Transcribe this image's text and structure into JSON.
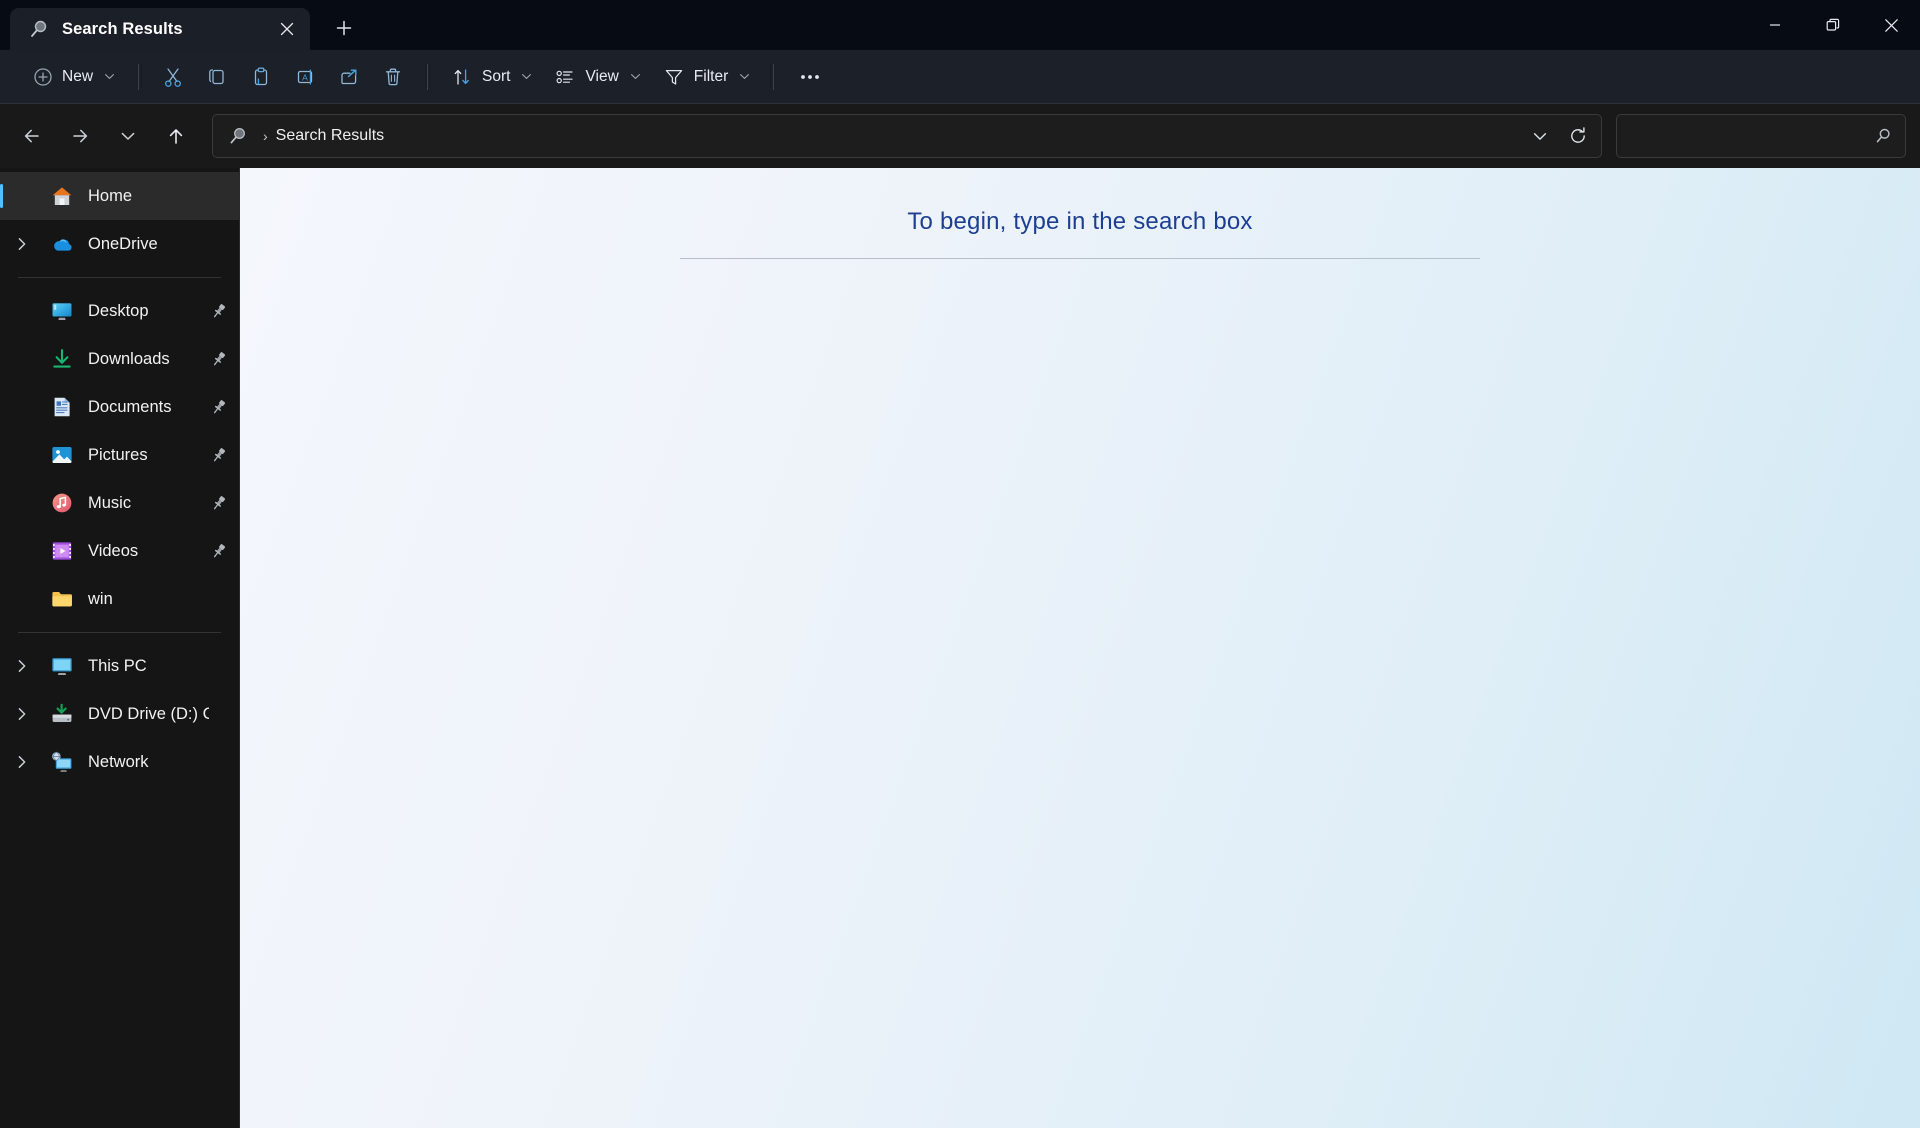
{
  "window": {
    "tab": {
      "title": "Search Results",
      "icon": "search-magnifier-icon",
      "close_label": "Close tab"
    },
    "new_tab_label": "+",
    "controls": {
      "minimize": "Minimize",
      "restore": "Restore",
      "close": "Close"
    }
  },
  "toolbar": {
    "new_label": "New",
    "cut_label": "Cut",
    "copy_label": "Copy",
    "paste_label": "Paste",
    "rename_label": "Rename",
    "share_label": "Share",
    "delete_label": "Delete",
    "sort_label": "Sort",
    "view_label": "View",
    "filter_label": "Filter",
    "more_label": "See more"
  },
  "navigation": {
    "back_label": "Back",
    "forward_label": "Forward",
    "recent_label": "Recent locations",
    "up_label": "Up to parent",
    "address": {
      "icon": "search-magnifier-icon",
      "separator": "›",
      "crumb": "Search Results",
      "dropdown_label": "Previous locations",
      "refresh_label": "Refresh"
    },
    "search": {
      "value": "",
      "placeholder": "",
      "icon": "search-icon"
    }
  },
  "sidebar": {
    "items": [
      {
        "label": "Home",
        "icon": "home-icon",
        "expandable": false,
        "selected": true,
        "pinned": false
      },
      {
        "label": "OneDrive",
        "icon": "onedrive-cloud-icon",
        "expandable": true,
        "selected": false,
        "pinned": false
      },
      {
        "divider": true
      },
      {
        "label": "Desktop",
        "icon": "desktop-icon",
        "expandable": false,
        "selected": false,
        "pinned": true
      },
      {
        "label": "Downloads",
        "icon": "downloads-icon",
        "expandable": false,
        "selected": false,
        "pinned": true
      },
      {
        "label": "Documents",
        "icon": "documents-icon",
        "expandable": false,
        "selected": false,
        "pinned": true
      },
      {
        "label": "Pictures",
        "icon": "pictures-icon",
        "expandable": false,
        "selected": false,
        "pinned": true
      },
      {
        "label": "Music",
        "icon": "music-icon",
        "expandable": false,
        "selected": false,
        "pinned": true
      },
      {
        "label": "Videos",
        "icon": "videos-icon",
        "expandable": false,
        "selected": false,
        "pinned": true
      },
      {
        "label": "win",
        "icon": "folder-icon",
        "expandable": false,
        "selected": false,
        "pinned": false
      },
      {
        "divider": true
      },
      {
        "label": "This PC",
        "icon": "this-pc-icon",
        "expandable": true,
        "selected": false,
        "pinned": false
      },
      {
        "label": "DVD Drive (D:) CCC",
        "icon": "dvd-drive-icon",
        "expandable": true,
        "selected": false,
        "pinned": false
      },
      {
        "label": "Network",
        "icon": "network-icon",
        "expandable": true,
        "selected": false,
        "pinned": false
      }
    ]
  },
  "content": {
    "empty_message": "To begin, type in the search box"
  },
  "colors": {
    "accent": "#4cc2ff",
    "titlebar_bg": "#070b14",
    "commandbar_bg": "#1b2029",
    "sidebar_bg": "#151515",
    "content_text": "#1c3f94"
  }
}
